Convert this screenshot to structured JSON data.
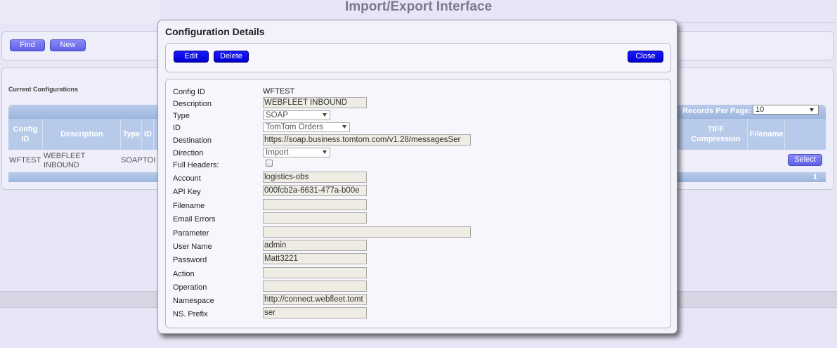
{
  "page": {
    "title": "Import/Export Interface"
  },
  "toolbar": {
    "find_label": "Find",
    "new_label": "New"
  },
  "configs": {
    "section_title": "Current Configurations",
    "records_per_page_label": "Records Per Page:",
    "records_per_page_value": "10",
    "columns": [
      "Config ID",
      "Description",
      "Type",
      "ID",
      "TIFF Compression",
      "Filename"
    ],
    "row": {
      "config_id": "WFTEST",
      "description": "WEBFLEET INBOUND",
      "type": "SOAP",
      "id": "TOI",
      "select_label": "Select"
    },
    "page_number": "1"
  },
  "modal": {
    "title": "Configuration Details",
    "edit_label": "Edit",
    "delete_label": "Delete",
    "close_label": "Close",
    "labels": {
      "config_id": "Config ID",
      "description": "Description",
      "type": "Type",
      "id": "ID",
      "destination": "Destination",
      "direction": "Direction",
      "full_headers": "Full Headers:",
      "account": "Account",
      "api_key": "API Key",
      "filename": "Filename",
      "email_errors": "Email Errors",
      "parameter": "Parameter",
      "user_name": "User Name",
      "password": "Password",
      "action": "Action",
      "operation": "Operation",
      "namespace": "Namespace",
      "ns_prefix": "NS. Prefix"
    },
    "values": {
      "config_id": "WFTEST",
      "description": "WEBFLEET INBOUND",
      "type": "SOAP",
      "id": "TomTom Orders",
      "destination": "https://soap.business.tomtom.com/v1.28/messagesSer",
      "direction": "Import",
      "full_headers": false,
      "account": "logistics-obs",
      "api_key": "000fcb2a-6631-477a-b00e",
      "filename": "",
      "email_errors": "",
      "parameter": "",
      "user_name": "admin",
      "password": "Matt3221",
      "action": "",
      "operation": "",
      "namespace": "http://connect.webfleet.tomt",
      "ns_prefix": "ser"
    }
  },
  "colors": {
    "primary_button": "#0000cc",
    "secondary_button": "#6a6aef",
    "grid_header": "#b8cae9",
    "page_background": "#e7e6f7"
  }
}
